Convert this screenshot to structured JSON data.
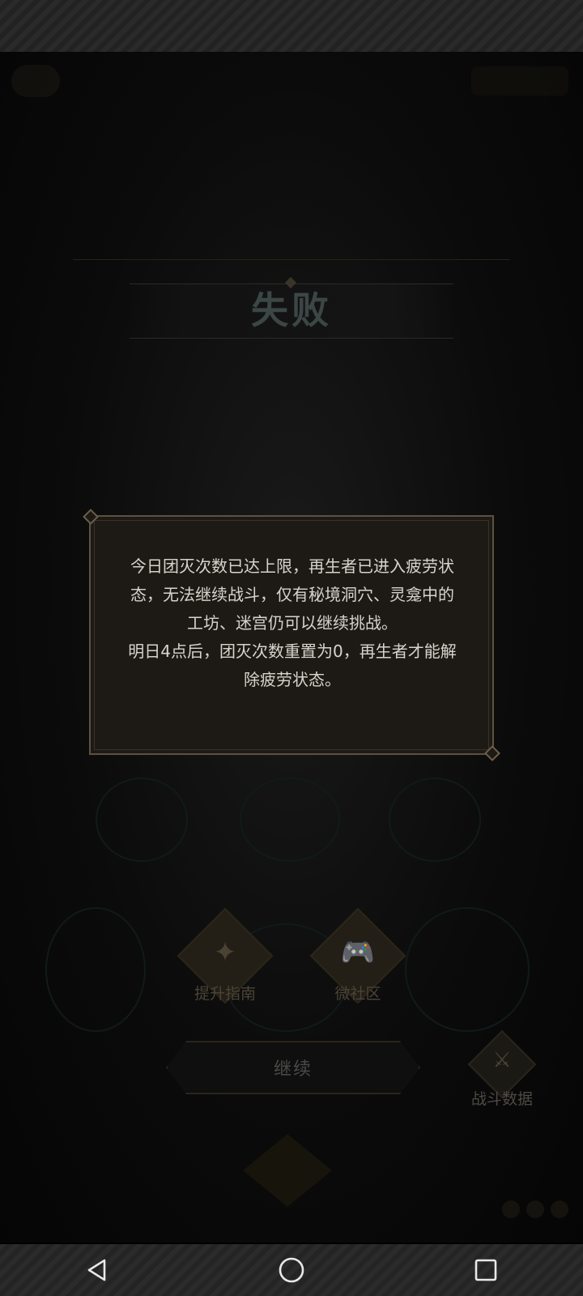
{
  "result_title": "失败",
  "dialog": {
    "paragraph1": "今日团灭次数已达上限，再生者已进入疲劳状态，无法继续战斗，仅有秘境洞穴、灵龛中的工坊、迷宫仍可以继续挑战。",
    "paragraph2": "明日4点后，团灭次数重置为0，再生者才能解除疲劳状态。"
  },
  "buttons": {
    "guide": "提升指南",
    "community": "微社区",
    "continue": "继续",
    "battle_stats": "战斗数据"
  },
  "icons": {
    "guide": "compass-icon",
    "community": "gamepad-icon",
    "battle_stats": "sword-icon",
    "nav_back": "triangle-back-icon",
    "nav_home": "circle-home-icon",
    "nav_recent": "square-recent-icon"
  },
  "colors": {
    "dialog_bg": "#1d1a16",
    "dialog_border": "#5d5140",
    "dialog_text": "#d8d4cc"
  }
}
